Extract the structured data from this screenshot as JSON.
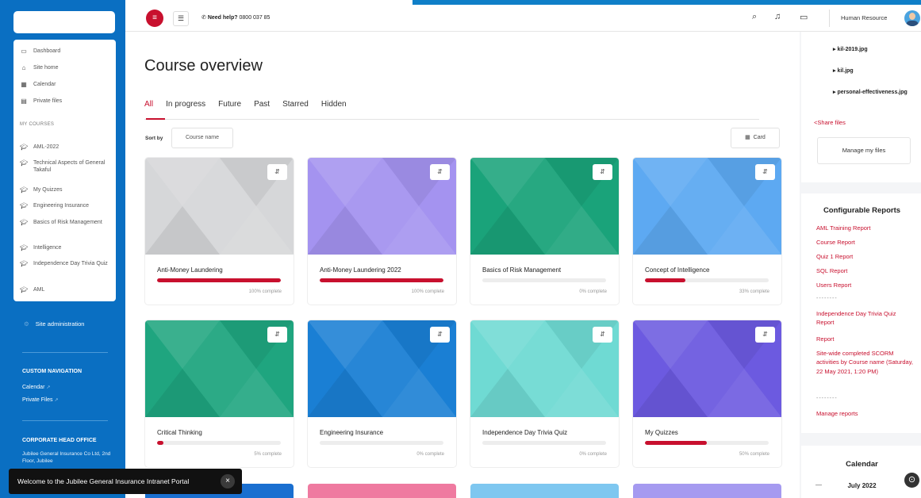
{
  "header": {
    "help_label": "Need help?",
    "help_phone": "0800 037 85",
    "username": "Human Resource"
  },
  "sidebar": {
    "items": [
      {
        "label": "Dashboard",
        "icon": "dashboard-icon"
      },
      {
        "label": "Site home",
        "icon": "home-icon"
      },
      {
        "label": "Calendar",
        "icon": "calendar-icon"
      },
      {
        "label": "Private files",
        "icon": "files-icon"
      }
    ],
    "my_courses_heading": "MY COURSES",
    "courses": [
      "AML-2022",
      "Technical Aspects of General Takaful",
      "My Quizzes",
      "Engineering Insurance",
      "Basics of Risk Management",
      "Intelligence",
      "Independence Day Trivia Quiz",
      "AML"
    ],
    "site_admin": "Site administration",
    "custom_nav_heading": "CUSTOM NAVIGATION",
    "custom_links": [
      "Calendar",
      "Private Files"
    ],
    "office_heading": "CORPORATE HEAD OFFICE",
    "office_text": "Jubilee General Insurance Co Ltd, 2nd Floor, Jubilee"
  },
  "toast": {
    "text": "Welcome to the Jubilee General Insurance Intranet Portal",
    "close": "×"
  },
  "main": {
    "title": "Course overview",
    "tabs": [
      "All",
      "In progress",
      "Future",
      "Past",
      "Starred",
      "Hidden"
    ],
    "active_tab": "All",
    "sort_label": "Sort by",
    "sort_value": "Course name",
    "view_value": "Card",
    "courses": [
      {
        "name": "Anti-Money Laundering",
        "progress": 100,
        "pct_label": "100% complete",
        "color": "#d6d7d9"
      },
      {
        "name": "Anti-Money Laundering 2022",
        "progress": 100,
        "pct_label": "100% complete",
        "color": "#a493f0"
      },
      {
        "name": "Basics of Risk Management",
        "progress": 0,
        "pct_label": "0% complete",
        "color": "#1aa37a"
      },
      {
        "name": "Concept of Intelligence",
        "progress": 33,
        "pct_label": "33% complete",
        "color": "#5da9f2"
      },
      {
        "name": "Critical Thinking",
        "progress": 5,
        "pct_label": "5% complete",
        "color": "#1fa57f"
      },
      {
        "name": "Engineering Insurance",
        "progress": 0,
        "pct_label": "0% complete",
        "color": "#1a7fd4"
      },
      {
        "name": "Independence Day Trivia Quiz",
        "progress": 0,
        "pct_label": "0% complete",
        "color": "#6fdad3"
      },
      {
        "name": "My Quizzes",
        "progress": 50,
        "pct_label": "50% complete",
        "color": "#6c5ae0"
      }
    ],
    "partial_colors": [
      "#1a6fd0",
      "#ef7aa0",
      "#7ec7f0",
      "#a59af0"
    ]
  },
  "right": {
    "files": [
      "kil-2019.jpg",
      "kil.jpg",
      "personal-effectiveness.jpg"
    ],
    "share_label": "Share files",
    "manage_files": "Manage my files",
    "reports_heading": "Configurable Reports",
    "reports": [
      "AML Training Report",
      "Course Report",
      "Quiz 1 Report",
      "SQL Report",
      "Users Report",
      "--------",
      "Independence Day Trivia Quiz Report",
      "Report",
      "Site-wide completed SCORM activities by Course name (Saturday, 22 May 2021, 1:20 PM)",
      "--------",
      "Manage reports"
    ],
    "calendar_heading": "Calendar",
    "calendar_month": "July 2022"
  },
  "colors": {
    "accent": "#c8102e",
    "sidebar": "#0a6fc2"
  }
}
